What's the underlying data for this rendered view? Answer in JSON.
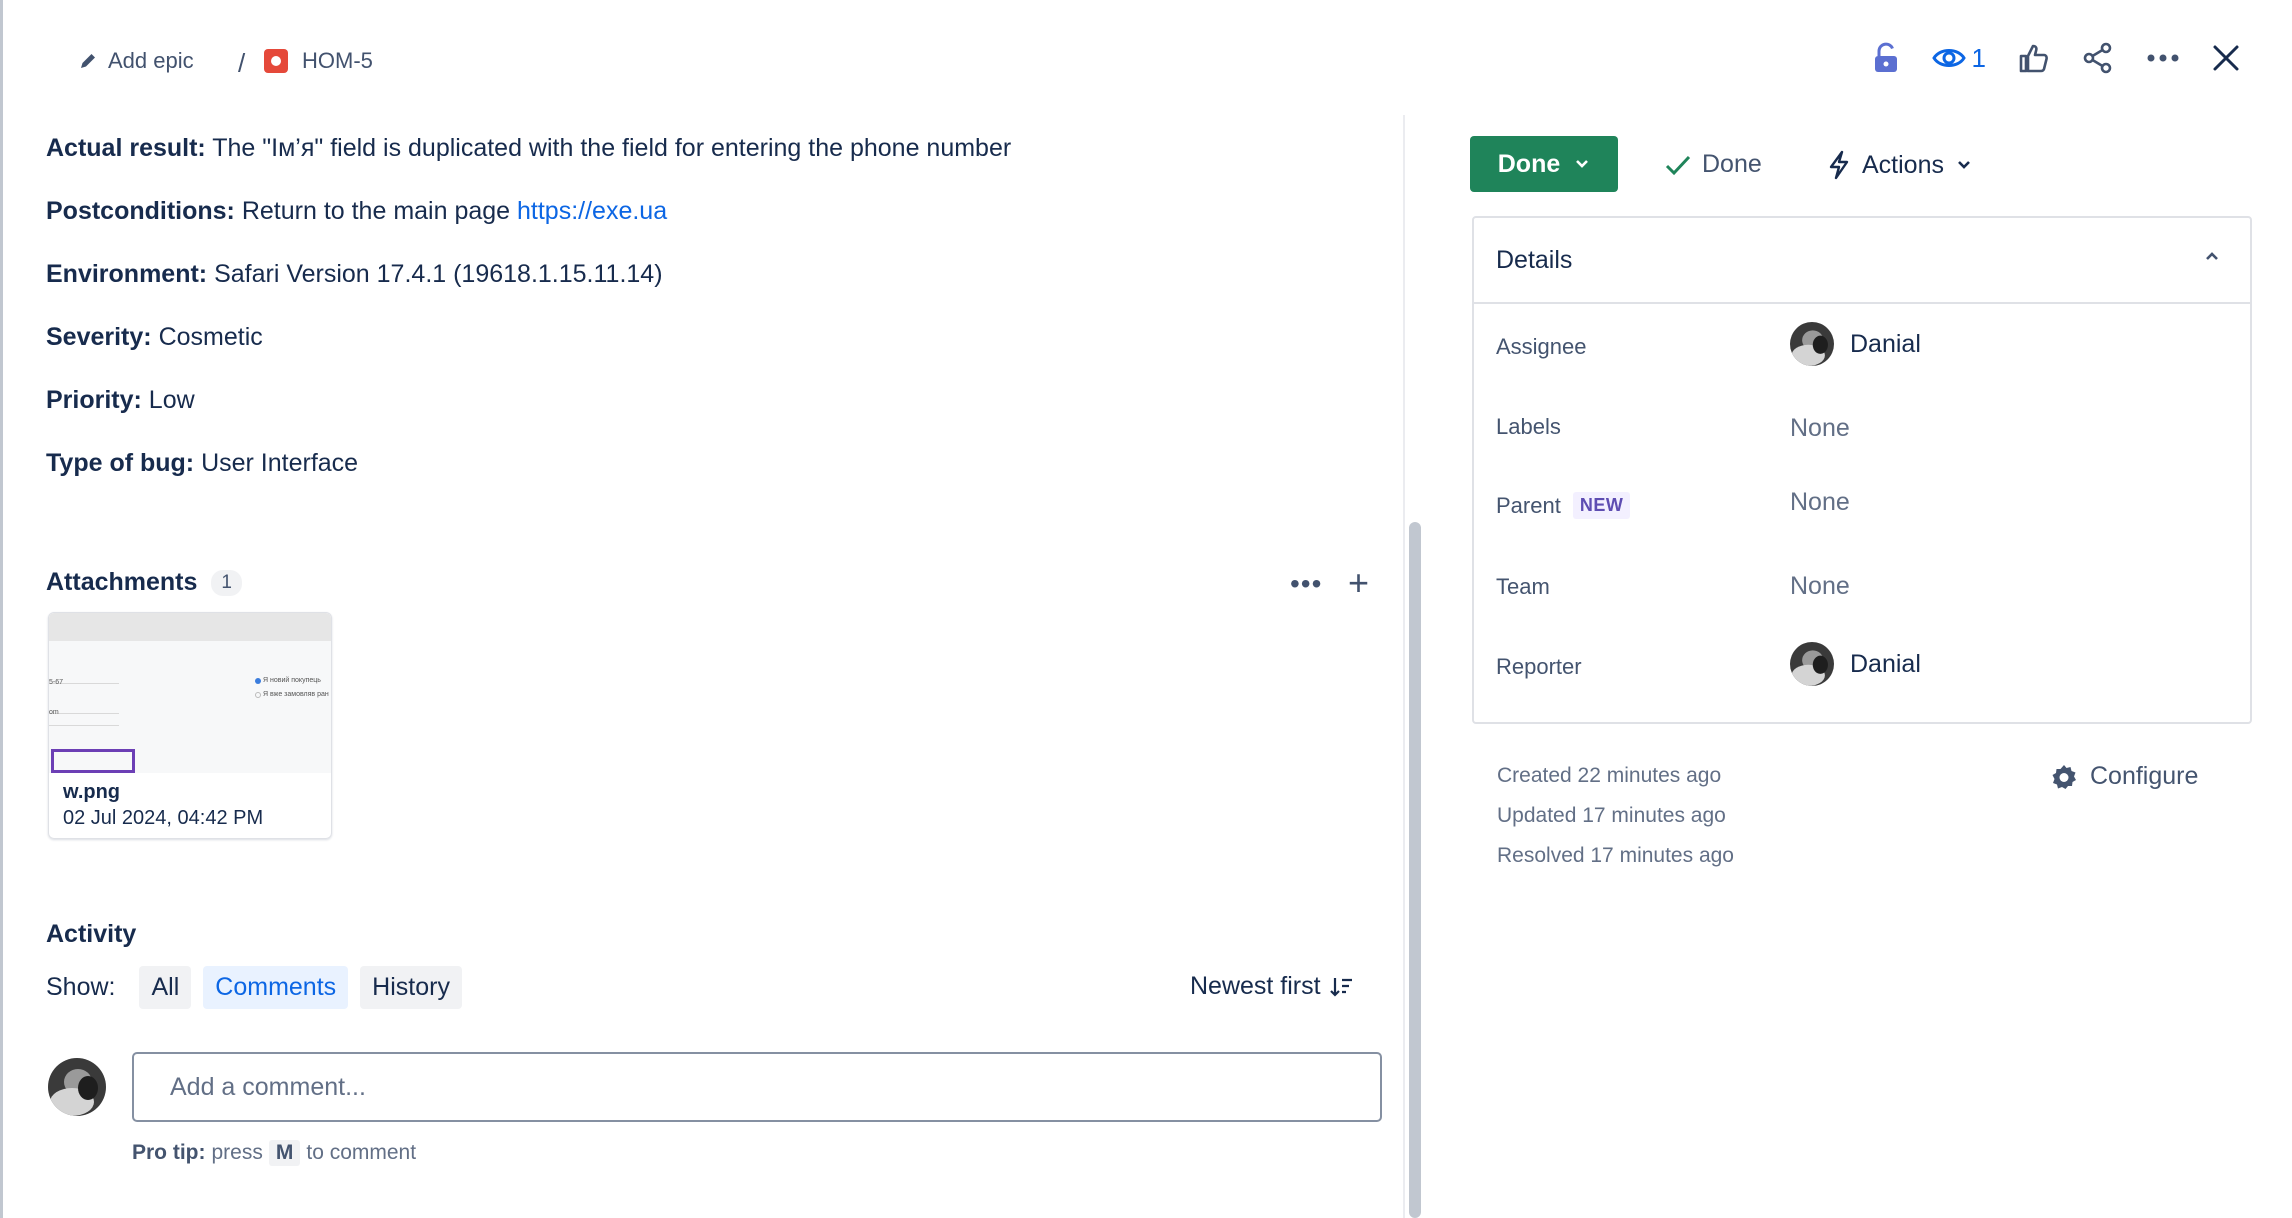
{
  "breadcrumb": {
    "add_epic_label": "Add epic",
    "separator": "/",
    "issue_key": "HOM-5"
  },
  "header_actions": {
    "watchers_count": "1",
    "icons": [
      "unlock-icon",
      "eye-icon",
      "thumbs-up-icon",
      "share-icon",
      "more-icon",
      "close-icon"
    ]
  },
  "description": {
    "rows": [
      {
        "label": "Actual result:",
        "text": " The \"Ім’я\" field is duplicated with the field for entering the phone number"
      },
      {
        "label": "Postconditions:",
        "text": " Return to the main page ",
        "link": "https://exe.ua"
      },
      {
        "label": "Environment:",
        "text": " Safari Version 17.4.1 (19618.1.15.11.14)"
      },
      {
        "label": "Severity:",
        "text": " Cosmetic"
      },
      {
        "label": "Priority:",
        "text": " Low"
      },
      {
        "label": "Type of bug:",
        "text": " User Interface"
      }
    ]
  },
  "attachments": {
    "title": "Attachments",
    "count": "1",
    "more_label": "•••",
    "add_label": "+",
    "items": [
      {
        "name": "w.png",
        "date": "02 Jul 2024, 04:42 PM",
        "thumb_text": [
          "Я новий покупець",
          "Я вже замовляв ран",
          "5-67",
          "om"
        ]
      }
    ]
  },
  "activity": {
    "title": "Activity",
    "show_label": "Show:",
    "filters": [
      {
        "label": "All",
        "active": false
      },
      {
        "label": "Comments",
        "active": true
      },
      {
        "label": "History",
        "active": false
      }
    ],
    "sort_label": "Newest first",
    "comment_placeholder": "Add a comment...",
    "pro_tip_bold": "Pro tip:",
    "pro_tip_text": "press",
    "pro_tip_key": "M",
    "pro_tip_suffix": "to comment"
  },
  "sidebar": {
    "status_label": "Done",
    "resolution_label": "Done",
    "actions_label": "Actions",
    "details": {
      "title": "Details",
      "rows": [
        {
          "label": "Assignee",
          "value": "Danial",
          "has_avatar": true
        },
        {
          "label": "Labels",
          "value": "None"
        },
        {
          "label": "Parent",
          "badge": "NEW",
          "value": "None"
        },
        {
          "label": "Team",
          "value": "None"
        },
        {
          "label": "Reporter",
          "value": "Danial",
          "has_avatar": true
        }
      ]
    },
    "meta": {
      "created": "Created 22 minutes ago",
      "updated": "Updated 17 minutes ago",
      "resolved": "Resolved 17 minutes ago"
    },
    "configure_label": "Configure"
  },
  "colors": {
    "status_green": "#1f845a",
    "link_blue": "#0c66e4",
    "bug_red": "#e5493a",
    "new_badge_purple": "#5e4db2"
  }
}
